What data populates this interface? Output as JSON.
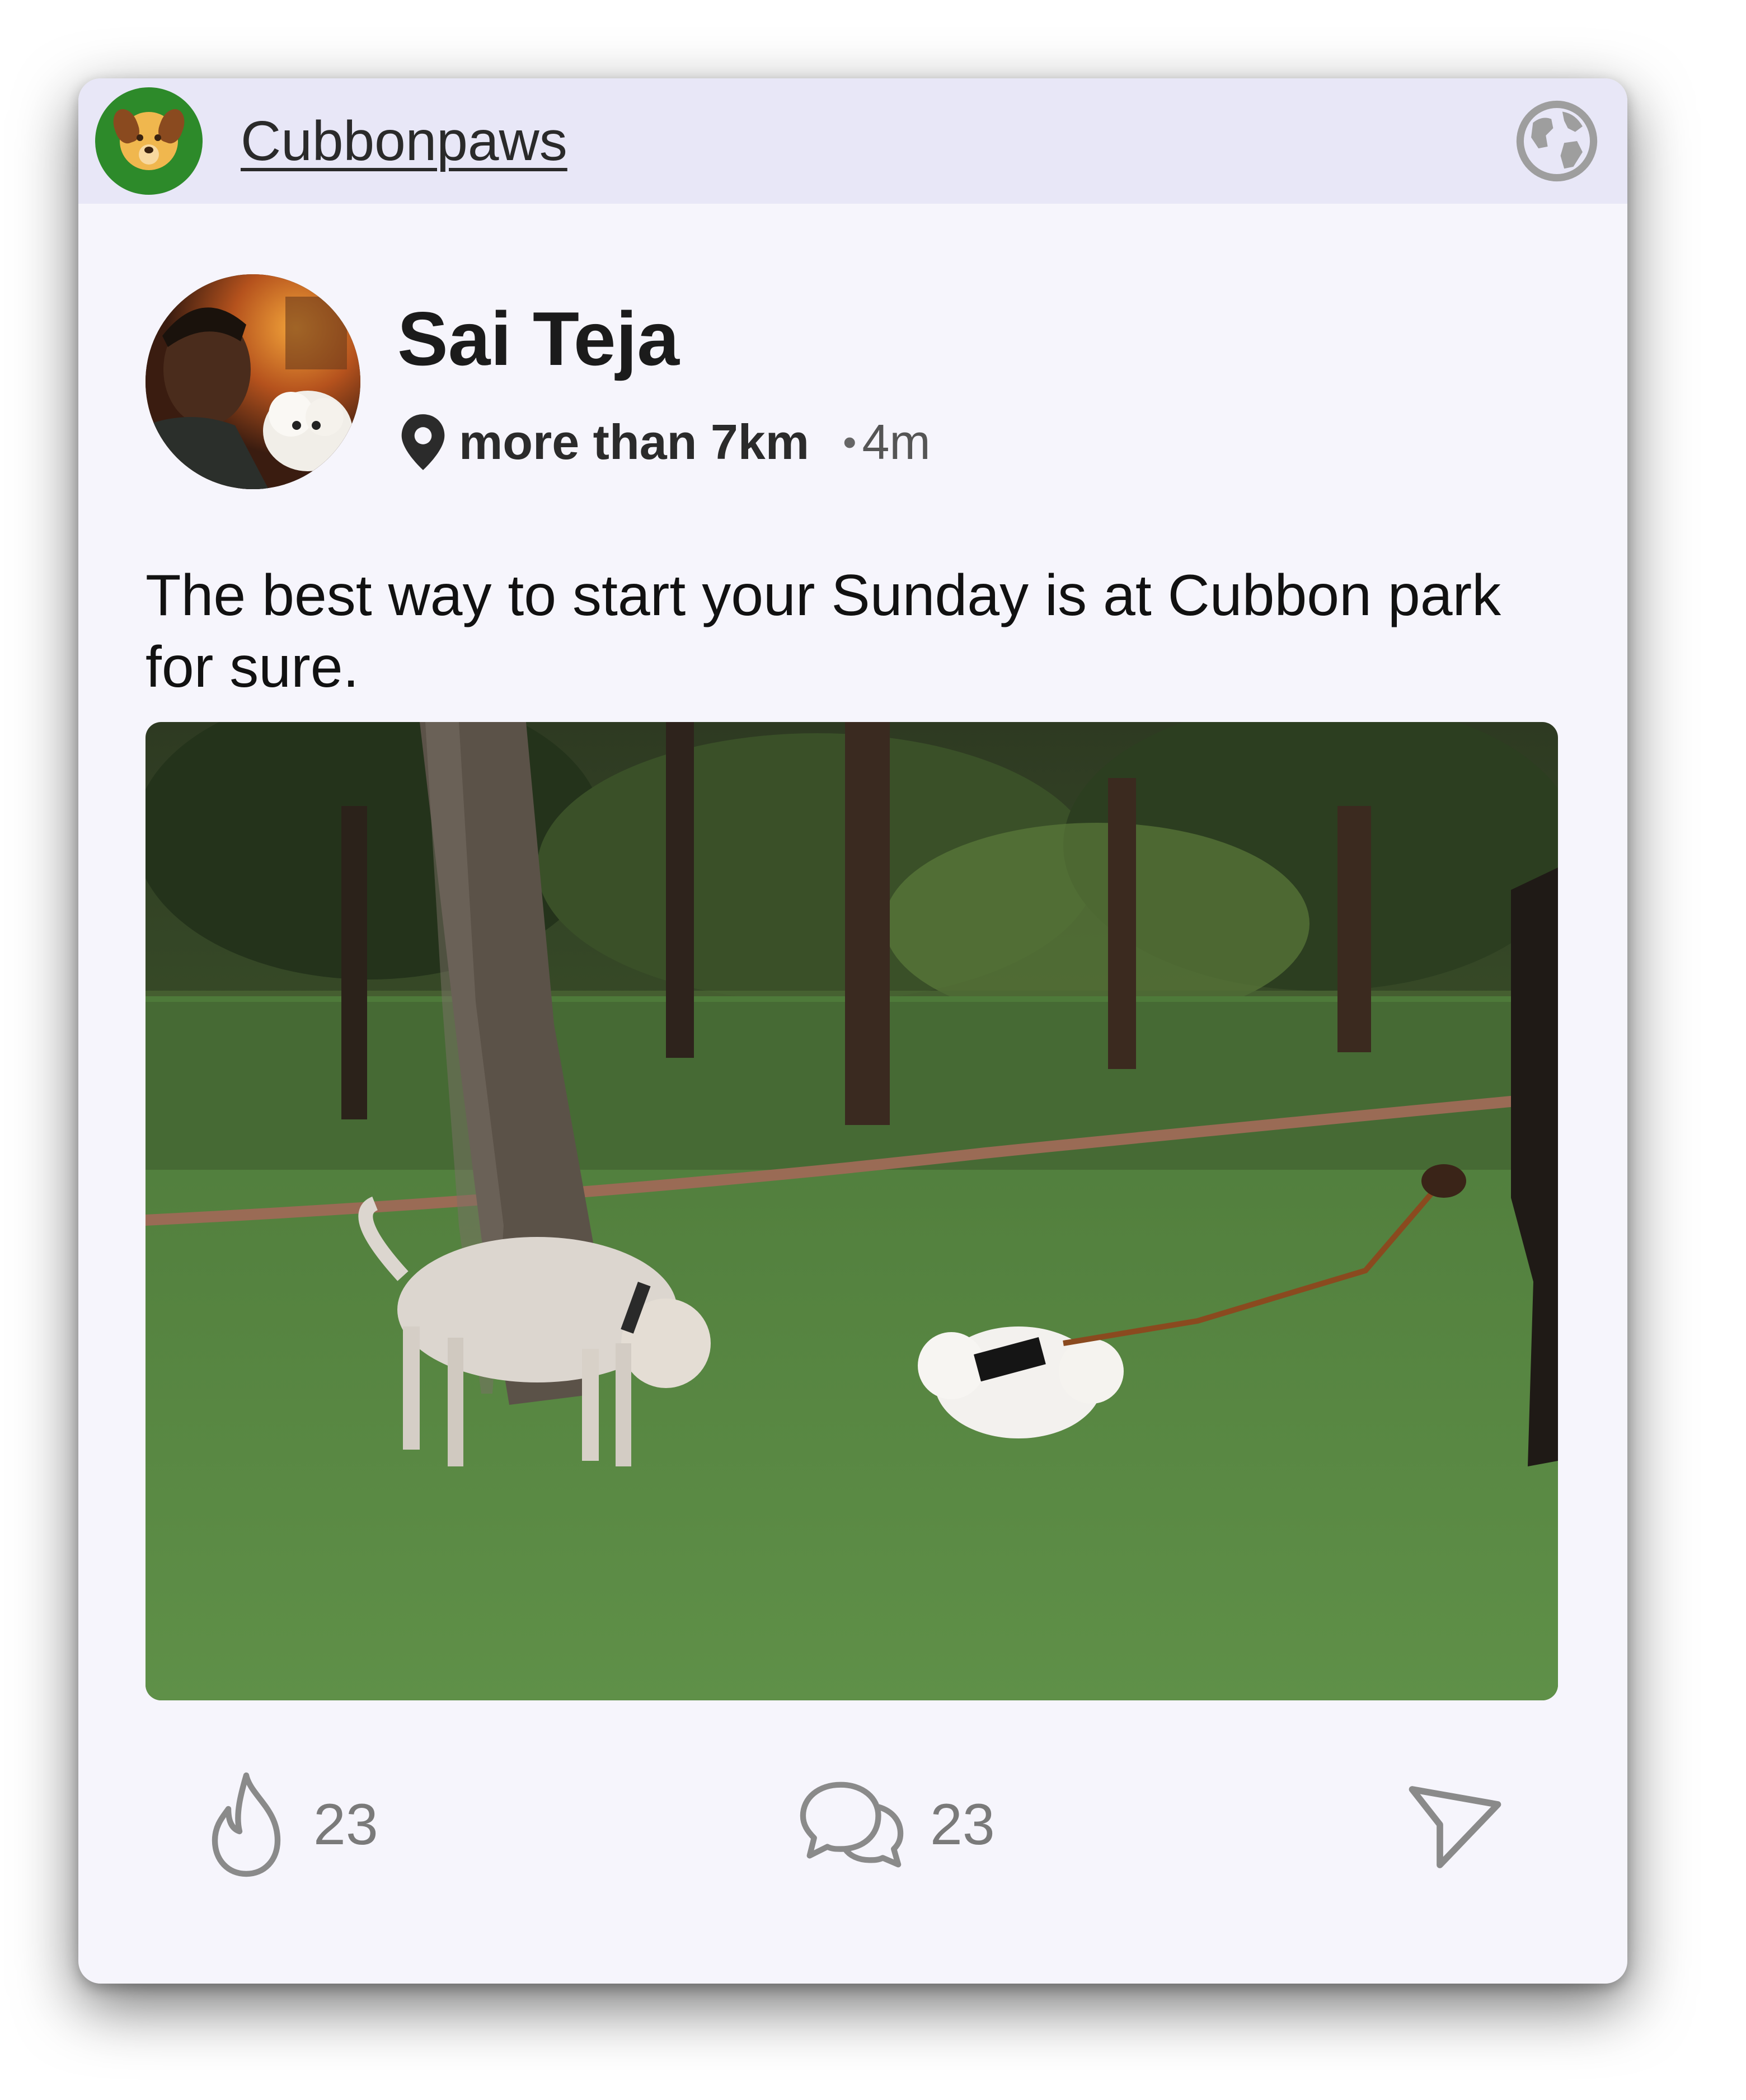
{
  "community": {
    "name": "Cubbonpaws",
    "logo_icon": "dog-face-icon",
    "visibility_icon": "globe-icon"
  },
  "post": {
    "author": "Sai Teja",
    "location_icon": "map-pin-icon",
    "distance": "more than 7km",
    "separator": "•",
    "time_ago": "4m",
    "text": "The best way to start your Sunday is at Cubbon park for sure."
  },
  "actions": {
    "like": {
      "icon": "flame-icon",
      "count": "23"
    },
    "comment": {
      "icon": "chat-bubbles-icon",
      "count": "23"
    },
    "share": {
      "icon": "send-icon"
    }
  },
  "colors": {
    "card_bg": "#f6f5fc",
    "header_bg": "#e8e7f7",
    "logo_green": "#2d8a2a",
    "muted_gray": "#7a7a7a"
  }
}
